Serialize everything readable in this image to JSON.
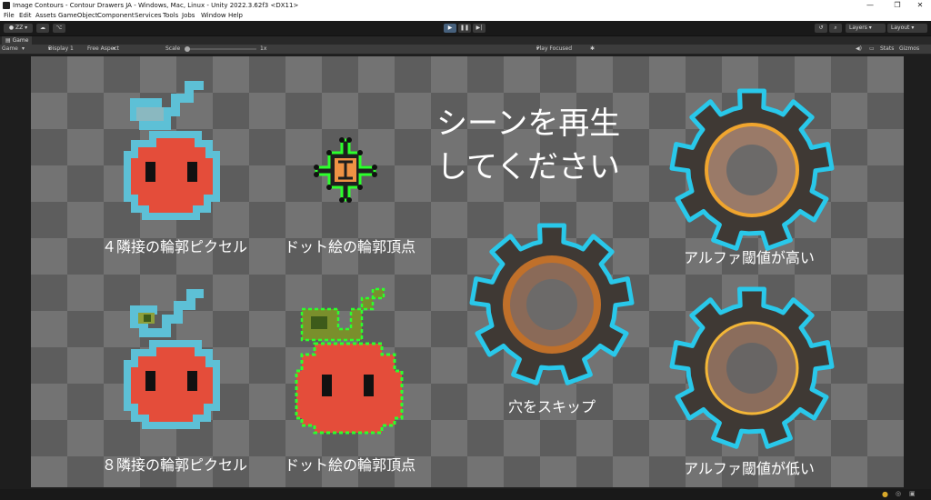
{
  "window": {
    "title": "Image Contours - Contour Drawers JA - Windows, Mac, Linux - Unity 2022.3.62f3 <DX11>"
  },
  "menu": [
    "File",
    "Edit",
    "Assets",
    "GameObject",
    "Component",
    "Services",
    "Tools",
    "Jobs",
    "Window",
    "Help"
  ],
  "toolbar": {
    "account": "ZZ",
    "layers": "Layers",
    "layout": "Layout"
  },
  "game_tab": {
    "label": "Game"
  },
  "game_toolbar": {
    "mode": "Game",
    "display": "Display 1",
    "aspect": "Free Aspect",
    "scale_label": "Scale",
    "scale_value": "1x",
    "play_focused": "Play Focused",
    "stats": "Stats",
    "gizmos": "Gizmos"
  },
  "scene": {
    "prompt_line1": "シーンを再生",
    "prompt_line2": "してください",
    "label_4neighbor": "４隣接の輪郭ピクセル",
    "label_dot_vertices_top": "ドット絵の輪郭頂点",
    "label_8neighbor": "８隣接の輪郭ピクセル",
    "label_dot_vertices_bottom": "ドット絵の輪郭頂点",
    "label_skip_holes": "穴をスキップ",
    "label_alpha_high": "アルファ閾値が高い",
    "label_alpha_low": "アルファ閾値が低い"
  },
  "colors": {
    "apple_red": "#e44d3a",
    "contour_blue": "#5dc0d6",
    "dot_green": "#2cff2c",
    "gear_dark": "#3f3934",
    "gear_ring": "#d88a2a",
    "gear_outline": "#29c8ea"
  }
}
